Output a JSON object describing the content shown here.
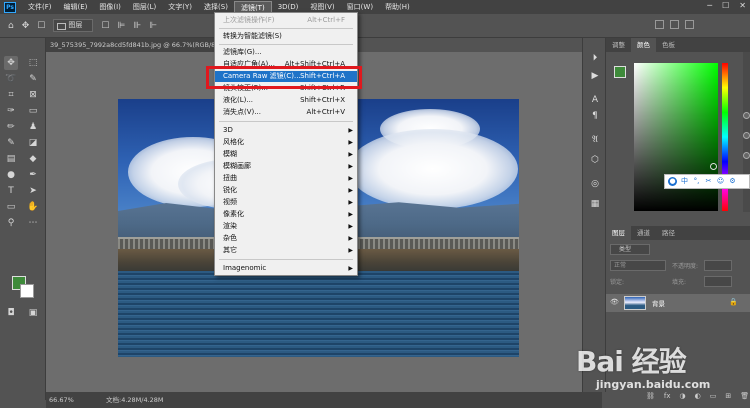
{
  "menubar": {
    "items": [
      "文件(F)",
      "编辑(E)",
      "图像(I)",
      "图层(L)",
      "文字(Y)",
      "选择(S)",
      "滤镜(T)",
      "3D(D)",
      "视图(V)",
      "窗口(W)",
      "帮助(H)"
    ],
    "active_index": 6
  },
  "optbar": {
    "layer_select": "图层"
  },
  "document": {
    "tab_title": "39_575395_7992a8cd5fd841b.jpg @ 66.7%(RGB/8#)",
    "zoom": "66.67%",
    "doc_info": "文档:4.28M/4.28M"
  },
  "filter_menu": {
    "last_filter": {
      "label": "上次滤镜操作(F)",
      "shortcut": "Alt+Ctrl+F"
    },
    "convert_smart": "转换为智能滤镜(S)",
    "gallery": "滤镜库(G)...",
    "adaptive_wide": {
      "label": "自适应广角(A)...",
      "shortcut": "Alt+Shift+Ctrl+A"
    },
    "camera_raw": {
      "label": "Camera Raw 滤镜(C)...",
      "shortcut": "Shift+Ctrl+A"
    },
    "lens_correction": {
      "label": "镜头校正(R)...",
      "shortcut": "Shift+Ctrl+R"
    },
    "liquify": {
      "label": "液化(L)...",
      "shortcut": "Shift+Ctrl+X"
    },
    "vanishing_point": {
      "label": "消失点(V)...",
      "shortcut": "Alt+Ctrl+V"
    },
    "submenus": [
      "3D",
      "风格化",
      "模糊",
      "模糊画廊",
      "扭曲",
      "锐化",
      "视频",
      "像素化",
      "渲染",
      "杂色",
      "其它"
    ],
    "imagenomic": "Imagenomic"
  },
  "color_panel": {
    "tabs": [
      "调整",
      "颜色",
      "色板"
    ],
    "active_tab": 1,
    "foreground": "#3e8a3a",
    "background": "#ffffff"
  },
  "float_toolbar": {
    "lang": "中"
  },
  "layers_panel": {
    "tabs": [
      "图层",
      "通道",
      "路径"
    ],
    "kind": "类型",
    "blend_mode": "正常",
    "opacity_label": "不透明度:",
    "lock_label": "锁定:",
    "fill_label": "填充:",
    "layer_name": "背景"
  },
  "watermark": {
    "main": "Bai 经验",
    "sub": "jingyan.baidu.com"
  }
}
